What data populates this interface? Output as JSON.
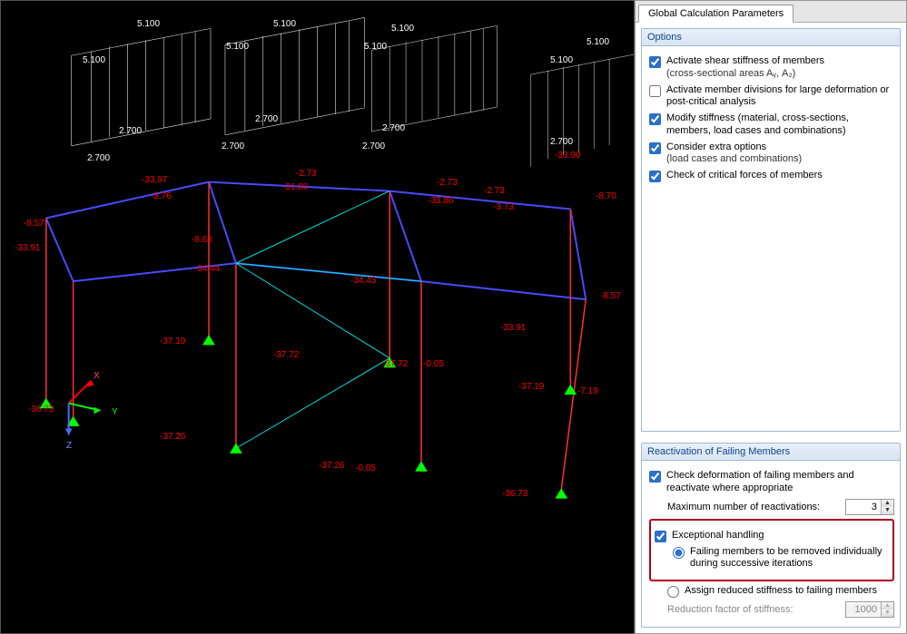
{
  "tabs": {
    "global": "Global Calculation Parameters"
  },
  "options_group": {
    "title": "Options",
    "shear": {
      "checked": true,
      "label": "Activate shear stiffness of members",
      "sub": "(cross-sectional areas Aᵧ, A₂)"
    },
    "divisions": {
      "checked": false,
      "label": "Activate member divisions for large deformation or post-critical analysis"
    },
    "modify": {
      "checked": true,
      "label": "Modify stiffness (material, cross-sections, members, load cases and combinations)"
    },
    "extra": {
      "checked": true,
      "label": "Consider extra options",
      "sub": "(load cases and combinations)"
    },
    "critical": {
      "checked": true,
      "label": "Check of critical forces of members"
    }
  },
  "reactivation_group": {
    "title": "Reactivation of Failing Members",
    "check_deform": {
      "checked": true,
      "label": "Check deformation of failing members and reactivate where appropriate"
    },
    "max_react_label": "Maximum number of reactivations:",
    "max_react_value": "3",
    "exceptional": {
      "checked": true,
      "label": "Exceptional handling"
    },
    "radio_remove": {
      "checked": true,
      "label": "Failing members to be removed individually during successive iterations"
    },
    "radio_assign": {
      "checked": false,
      "label": "Assign reduced stiffness to failing members"
    },
    "reduction_label": "Reduction factor of stiffness:",
    "reduction_value": "1000"
  },
  "axis": {
    "x": "X",
    "y": "Y",
    "z": "Z"
  },
  "scene": {
    "top_load": "5.100",
    "mid_load": "2.700",
    "labels_red": [
      "-8.57",
      "-33.91",
      "-36.73",
      "-37.26",
      "-37.19",
      "-8.63",
      "-34.44",
      "-3.76",
      "-33.97",
      "-2.73",
      "-31.80",
      "-37.26",
      "-37.72",
      "-0.05",
      "-34.43",
      "-2.73",
      "-33.86",
      "-37.72",
      "-37.19",
      "-0.05",
      "-33.90",
      "-8.70",
      "-33.91",
      "-8.57",
      "-36.73",
      "-7.19",
      "-3.73",
      "-2.73"
    ]
  }
}
